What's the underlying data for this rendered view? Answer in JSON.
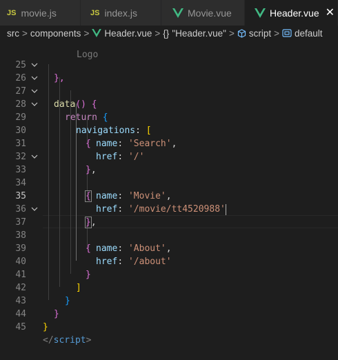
{
  "tabs": [
    {
      "icon": "JS",
      "label": "movie.js"
    },
    {
      "icon": "JS",
      "label": "index.js"
    },
    {
      "icon": "vue-icon",
      "label": "Movie.vue"
    },
    {
      "icon": "vue-icon",
      "label": "Header.vue",
      "active": true,
      "close": "✕"
    }
  ],
  "breadcrumb": {
    "items": [
      "src",
      "components",
      "Header.vue",
      "\"Header.vue\"",
      "script",
      "default"
    ],
    "separator": ">",
    "braces": "{}"
  },
  "editor": {
    "current_line": 35,
    "lines": [
      {
        "n": 25,
        "tokens": [
          "},"
        ]
      },
      {
        "n": 26,
        "tokens": [
          "data",
          "()",
          " {"
        ]
      },
      {
        "n": 27,
        "tokens": [
          "return",
          " {"
        ]
      },
      {
        "n": 28,
        "tokens": [
          "navigations",
          ":",
          " ["
        ]
      },
      {
        "n": 29,
        "tokens": [
          "{"
        ]
      },
      {
        "n": 30,
        "tokens": [
          "name",
          ":",
          "'Search'",
          ","
        ]
      },
      {
        "n": 31,
        "tokens": [
          "href",
          ":",
          "'/'"
        ]
      },
      {
        "n": 32,
        "tokens": [
          "}",
          ","
        ]
      },
      {
        "n": 33,
        "tokens": [
          "{"
        ]
      },
      {
        "n": 34,
        "tokens": [
          "name",
          ":",
          "'Movie'",
          ","
        ]
      },
      {
        "n": 35,
        "tokens": [
          "href",
          ":",
          "'/movie/tt4520988'"
        ]
      },
      {
        "n": 36,
        "tokens": [
          "}",
          ","
        ]
      },
      {
        "n": 37,
        "tokens": [
          "{"
        ]
      },
      {
        "n": 38,
        "tokens": [
          "name",
          ":",
          "'About'",
          ","
        ]
      },
      {
        "n": 39,
        "tokens": [
          "href",
          ":",
          "'/about'"
        ]
      },
      {
        "n": 40,
        "tokens": [
          "}"
        ]
      },
      {
        "n": 41,
        "tokens": [
          "]"
        ]
      },
      {
        "n": 42,
        "tokens": [
          "}"
        ]
      },
      {
        "n": 43,
        "tokens": [
          "}"
        ]
      },
      {
        "n": 44,
        "tokens": [
          "}"
        ]
      },
      {
        "n": 45,
        "tokens": [
          "</",
          "script",
          ">"
        ]
      }
    ]
  },
  "colors": {
    "editor_bg": "#1e1e1e",
    "keyword": "#c586c0",
    "function": "#dcdcaa",
    "property": "#9cdcfe",
    "string": "#ce9178",
    "vue_green": "#41b883",
    "js_yellow": "#cbcb41"
  }
}
